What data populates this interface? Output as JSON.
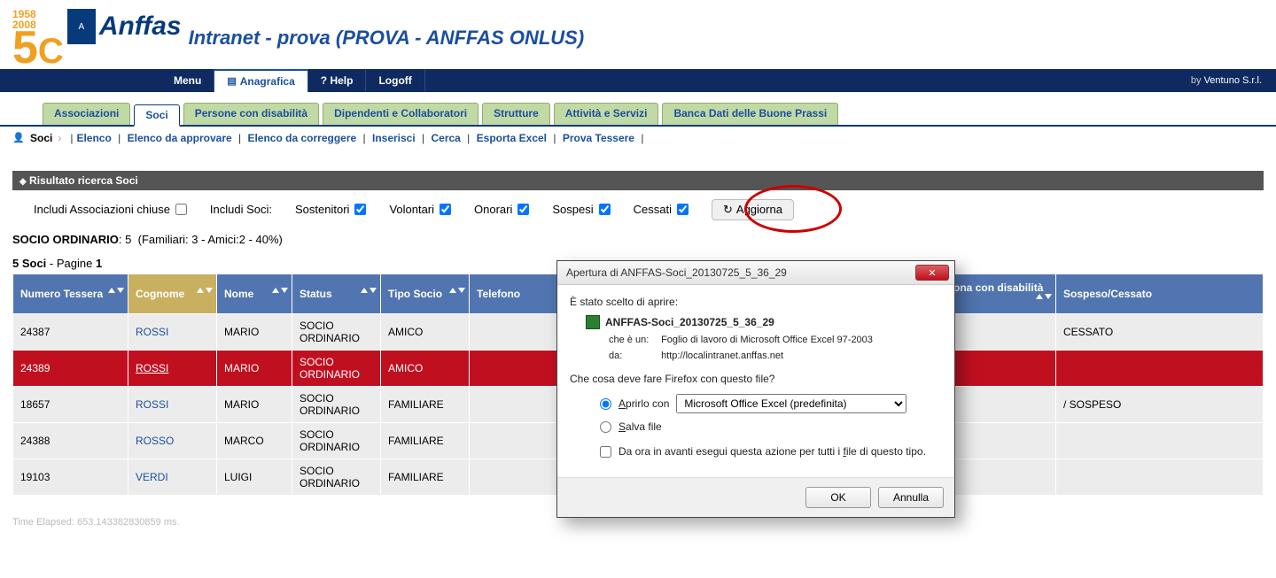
{
  "logo": {
    "yr1": "1958",
    "yr2": "2008",
    "big": "5",
    "c": "C",
    "name": "Anffas"
  },
  "header": {
    "title": "Intranet - prova (PROVA - ANFFAS ONLUS)"
  },
  "topbar": {
    "menu": "Menu",
    "anagrafica": "Anagrafica",
    "help": "? Help",
    "logoff": "Logoff",
    "by": "by",
    "company": "Ventuno S.r.l."
  },
  "tabs": [
    "Associazioni",
    "Soci",
    "Persone con disabilità",
    "Dipendenti e Collaboratori",
    "Strutture",
    "Attività e Servizi",
    "Banca Dati delle Buone Prassi"
  ],
  "activeTab": "Soci",
  "subnav": {
    "root": "Soci",
    "links": [
      "Elenco",
      "Elenco da approvare",
      "Elenco da correggere",
      "Inserisci",
      "Cerca",
      "Esporta Excel",
      "Prova Tessere"
    ]
  },
  "section": {
    "title": "Risultato ricerca Soci"
  },
  "filters": {
    "includeClosed": "Includi Associazioni chiuse",
    "includeSoci": "Includi Soci:",
    "sostenitori": "Sostenitori",
    "volontari": "Volontari",
    "onorari": "Onorari",
    "sospesi": "Sospesi",
    "cessati": "Cessati",
    "refresh": "Aggiorna",
    "closedChecked": false,
    "sostChecked": true,
    "volChecked": true,
    "onorChecked": true,
    "sospChecked": true,
    "cessChecked": true
  },
  "summary": {
    "label": "SOCIO ORDINARIO",
    "count": "5",
    "details": "(Familiari: 3 - Amici:2 - 40%)"
  },
  "pager": {
    "countLabel": "5 Soci",
    "pagine": "- Pagine",
    "page": "1"
  },
  "columns": {
    "tessera": "Numero Tessera",
    "cognome": "Cognome",
    "nome": "Nome",
    "status": "Status",
    "tipo": "Tipo Socio",
    "telefono": "Telefono",
    "pcd2": "Persona con disabilità 2",
    "sosp": "Sospeso/Cessato"
  },
  "rows": [
    {
      "tessera": "24387",
      "cognome": "ROSSI",
      "nome": "MARIO",
      "status": "SOCIO ORDINARIO",
      "tipo": "AMICO",
      "pcd2": "",
      "sosp": "CESSATO",
      "sel": false
    },
    {
      "tessera": "24389",
      "cognome": "ROSSI",
      "nome": "MARIO",
      "status": "SOCIO ORDINARIO",
      "tipo": "AMICO",
      "pcd2": "",
      "sosp": "",
      "sel": true
    },
    {
      "tessera": "18657",
      "cognome": "ROSSI",
      "nome": "MARIO",
      "status": "SOCIO ORDINARIO",
      "tipo": "FAMILIARE",
      "pcd2": "",
      "sosp": "/ SOSPESO",
      "sel": false
    },
    {
      "tessera": "24388",
      "cognome": "ROSSO",
      "nome": "MARCO",
      "status": "SOCIO ORDINARIO",
      "tipo": "FAMILIARE",
      "pcd2": "",
      "sosp": "",
      "sel": false
    },
    {
      "tessera": "19103",
      "cognome": "VERDI",
      "nome": "LUIGI",
      "status": "SOCIO ORDINARIO",
      "tipo": "FAMILIARE",
      "pcd2": "",
      "sosp": "",
      "sel": false
    }
  ],
  "elapsed": "Time Elapsed: 653.143382830859 ms.",
  "dialog": {
    "title": "Apertura di ANFFAS-Soci_20130725_5_36_29",
    "lead": "È stato scelto di aprire:",
    "filename": "ANFFAS-Soci_20130725_5_36_29",
    "typeLabel": "che è un:",
    "typeValue": "Foglio di lavoro di Microsoft Office Excel 97-2003",
    "fromLabel": "da:",
    "fromValue": "http://localintranet.anffas.net",
    "question": "Che cosa deve fare Firefox con questo file?",
    "openWith": "Aprirlo con",
    "openWithApp": "Microsoft Office Excel (predefinita)",
    "saveFile": "Salva file",
    "remember": "Da ora in avanti esegui questa azione per tutti i file di questo tipo.",
    "ok": "OK",
    "cancel": "Annulla"
  }
}
